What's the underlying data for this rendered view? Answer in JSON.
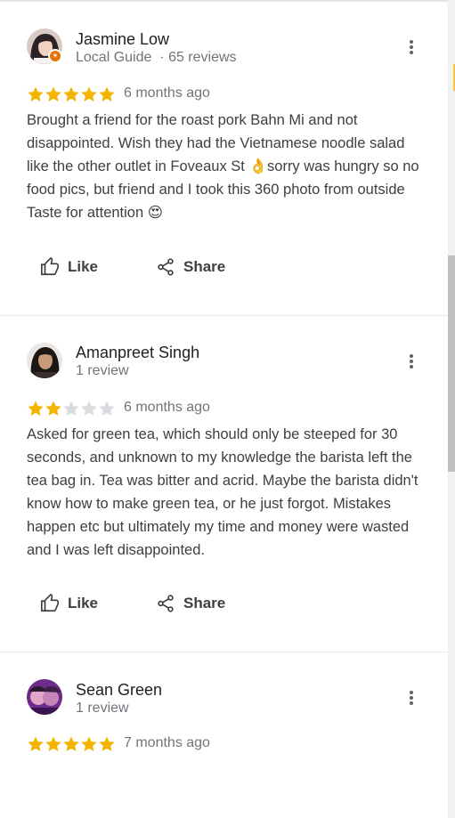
{
  "colors": {
    "star_filled": "#f4b400",
    "star_empty": "#dadce0",
    "badge": "#e8710a",
    "text_primary": "#202124",
    "text_secondary": "#70757a"
  },
  "reviews": [
    {
      "name": "Jasmine Low",
      "meta_role": "Local Guide",
      "meta_sep": "·",
      "meta_count": "65 reviews",
      "rating": 5,
      "time": "6 months ago",
      "text": "Brought a friend for the roast pork Bahn Mi and not disappointed. Wish they had the Vietnamese noodle salad like the other outlet in Foveaux St 👌sorry was hungry so no food pics, but friend and I took this 360 photo from outside Taste for attention 😍",
      "like_label": "Like",
      "share_label": "Share"
    },
    {
      "name": "Amanpreet Singh",
      "meta_count": "1 review",
      "rating": 2,
      "time": "6 months ago",
      "text": "Asked for green tea, which should only be steeped for 30 seconds, and unknown to my knowledge the barista left the tea bag in. Tea was bitter and acrid. Maybe the barista didn't know how to make green tea, or he just forgot. Mistakes happen etc but ultimately my time and money were wasted and I was left disappointed.",
      "like_label": "Like",
      "share_label": "Share"
    },
    {
      "name": "Sean Green",
      "meta_count": "1 review",
      "rating": 5,
      "time": "7 months ago"
    }
  ],
  "icons": {
    "menu": "more-vert-icon",
    "like": "thumb-up-icon",
    "share": "share-icon",
    "star": "star-icon"
  }
}
